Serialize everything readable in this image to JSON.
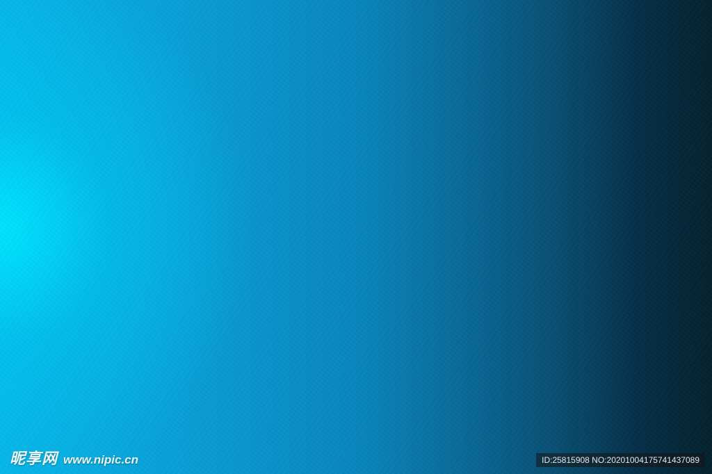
{
  "background": {
    "colors": [
      "#00e6ff",
      "#08b4e8",
      "#0a86bd",
      "#0a4f73",
      "#06222f"
    ],
    "description_style": "blue gradient texture"
  },
  "watermark": {
    "logo_text": "昵享网",
    "site_url": "www.nipic.cn",
    "id_text": "ID:25815908 NO:20201004175741437089"
  }
}
